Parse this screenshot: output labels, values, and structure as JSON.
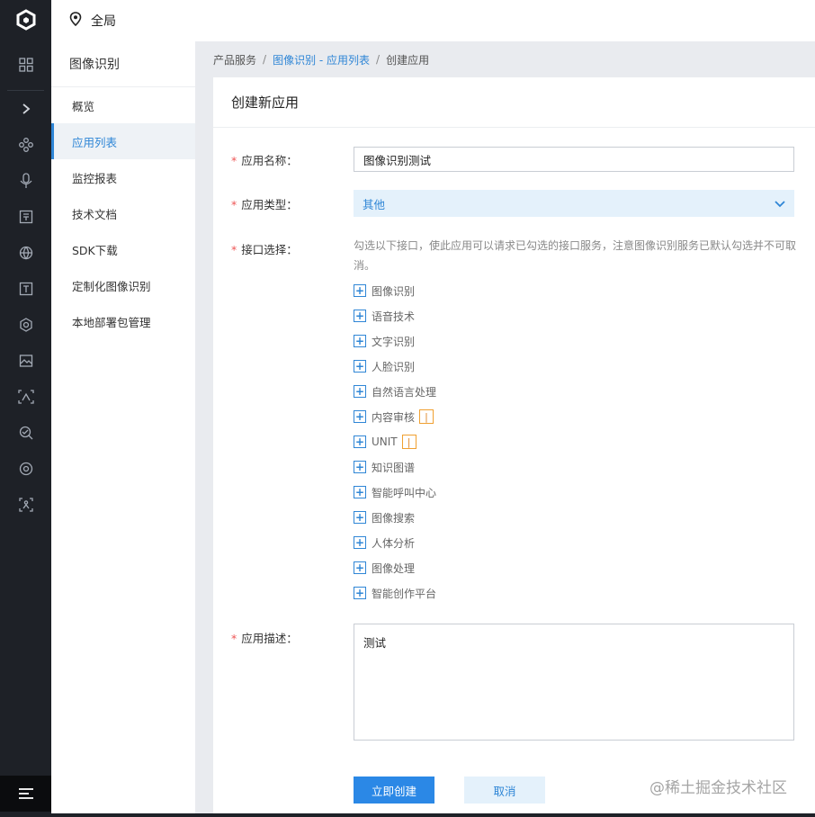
{
  "topbar": {
    "scope_label": "全局"
  },
  "rail": {
    "icons": [
      "logo-icon",
      "grid-icon",
      "chevron-right-icon",
      "nodes-icon",
      "mic-icon",
      "doc-scan-icon",
      "globe-icon",
      "text-t-icon",
      "hexagon-icon",
      "image-icon",
      "face-scan-icon",
      "search-eye-icon",
      "face-id-icon",
      "body-scan-icon",
      "menu-icon"
    ]
  },
  "subnav": {
    "title": "图像识别",
    "items": [
      {
        "label": "概览"
      },
      {
        "label": "应用列表",
        "active": true
      },
      {
        "label": "监控报表"
      },
      {
        "label": "技术文档"
      },
      {
        "label": "SDK下载"
      },
      {
        "label": "定制化图像识别"
      },
      {
        "label": "本地部署包管理"
      }
    ]
  },
  "breadcrumb": {
    "root": "产品服务",
    "link": "图像识别 - 应用列表",
    "current": "创建应用",
    "separator": "/"
  },
  "form": {
    "title": "创建新应用",
    "required_mark": "*",
    "name_label": "应用名称：",
    "name_value": "图像识别测试",
    "type_label": "应用类型：",
    "type_value": "其他",
    "api_label": "接口选择：",
    "api_hint": "勾选以下接口，使此应用可以请求已勾选的接口服务，注意图像识别服务已默认勾选并不可取消。",
    "services": [
      {
        "name": "图像识别"
      },
      {
        "name": "语音技术"
      },
      {
        "name": "文字识别"
      },
      {
        "name": "人脸识别"
      },
      {
        "name": "自然语言处理"
      },
      {
        "name": "内容审核",
        "badge": "|"
      },
      {
        "name": "UNIT",
        "badge": "|"
      },
      {
        "name": "知识图谱"
      },
      {
        "name": "智能呼叫中心"
      },
      {
        "name": "图像搜索"
      },
      {
        "name": "人体分析"
      },
      {
        "name": "图像处理"
      },
      {
        "name": "智能创作平台"
      }
    ],
    "desc_label": "应用描述：",
    "desc_value": "测试",
    "submit_label": "立即创建",
    "cancel_label": "取消"
  },
  "watermark": "@稀土掘金技术社区",
  "colors": {
    "accent": "#2f86d6",
    "primary_button": "#2b88e6",
    "rail_bg": "#1e2127",
    "required": "#ee5555"
  }
}
